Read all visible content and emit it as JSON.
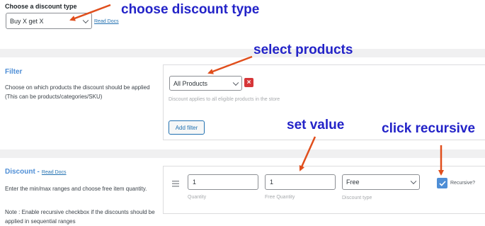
{
  "discount_type": {
    "label": "Choose a discount type",
    "selected": "Buy X get X",
    "docs_link": "Read Docs"
  },
  "filter": {
    "title": "Filter",
    "description": "Choose on which products the discount should be applied (This can be products/categories/SKU)",
    "selected": "All Products",
    "remove_icon": "×",
    "hint": "Discount applies to all eligible products in the store",
    "add_button": "Add filter"
  },
  "discount": {
    "title": "Discount -",
    "docs_link": "Read Docs",
    "description": "Enter the min/max ranges and choose free item quantity.",
    "note": "Note : Enable recursive checkbox if the discounts should be applied in sequential ranges",
    "quantity_value": "1",
    "quantity_label": "Quantity",
    "free_quantity_value": "1",
    "free_quantity_label": "Free Quantity",
    "discount_type_value": "Free",
    "discount_type_label": "Discount type",
    "recursive_label": "Recursive?",
    "recursive_checked": true
  },
  "annotations": {
    "choose_type": "choose discount type",
    "select_products": "select products",
    "set_value": "set value",
    "click_recursive": "click recursive",
    "color": "#2323c8",
    "arrow_color": "#e04e1c"
  }
}
